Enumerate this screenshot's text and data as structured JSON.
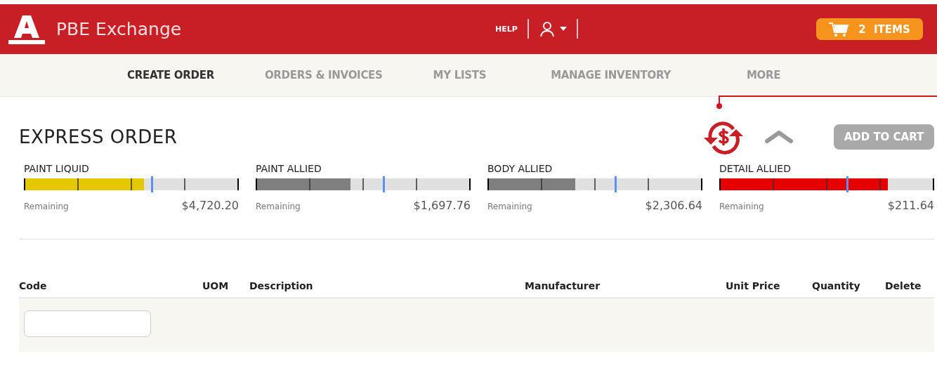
{
  "header": {
    "brand": "PBE Exchange",
    "help": "HELP",
    "cart": "2 ITEMS"
  },
  "nav": [
    {
      "label": "CREATE ORDER",
      "selected": true
    },
    {
      "label": "ORDERS & INVOICES",
      "selected": false
    },
    {
      "label": "MY LISTS",
      "selected": false
    },
    {
      "label": "MANAGE INVENTORY",
      "selected": false
    },
    {
      "label": "MORE",
      "selected": false
    }
  ],
  "page": {
    "title": "EXPRESS ORDER",
    "add_to_cart": {
      "label": "ADD TO CART",
      "disabled": true
    }
  },
  "budgets": [
    {
      "name": "PAINT LIQUID",
      "level": 0.56,
      "color": "#e6c800",
      "target": {
        "level": 0.59
      },
      "caption": "Remaining",
      "amount": "$4,720.20"
    },
    {
      "name": "PAINT ALLIED",
      "level": 0.44,
      "color": "#7f7f7f",
      "target": {
        "level": 0.59
      },
      "caption": "Remaining",
      "amount": "$1,697.76"
    },
    {
      "name": "BODY ALLIED",
      "level": 0.41,
      "color": "#7f7f7f",
      "target": {
        "level": 0.59
      },
      "caption": "Remaining",
      "amount": "$2,306.64"
    },
    {
      "name": "DETAIL ALLIED",
      "level": 0.785,
      "color": "#e60000",
      "target": {
        "level": 0.59
      },
      "caption": "Remaining",
      "amount": "$211.64"
    }
  ],
  "table": {
    "columns": [
      "Code",
      "UOM",
      "Description",
      "Manufacturer",
      "Unit Price",
      "Quantity",
      "Delete"
    ]
  }
}
